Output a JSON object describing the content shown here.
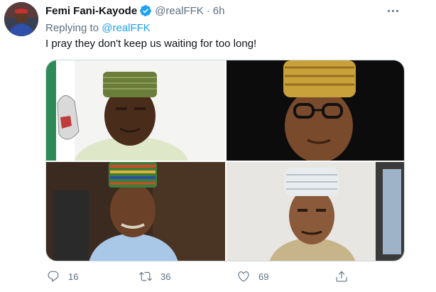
{
  "tweet": {
    "author_name": "Femi Fani-Kayode",
    "handle": "@realFFK",
    "separator": "·",
    "time": "6h",
    "replying_prefix": "Replying to ",
    "replying_to": "@realFFK",
    "text": "I pray they don't keep us waiting for too long!",
    "media_count": 4
  },
  "actions": {
    "replies": "16",
    "retweets": "36",
    "likes": "69"
  },
  "icons": {
    "verified": "verified-badge-icon",
    "more": "more-options-icon",
    "reply": "reply-icon",
    "retweet": "retweet-icon",
    "like": "heart-icon",
    "share": "share-icon"
  },
  "colors": {
    "text": "#0f1419",
    "secondary": "#5b7083",
    "link": "#1da1f2",
    "verified": "#1da1f2",
    "border": "#cfd9de"
  }
}
